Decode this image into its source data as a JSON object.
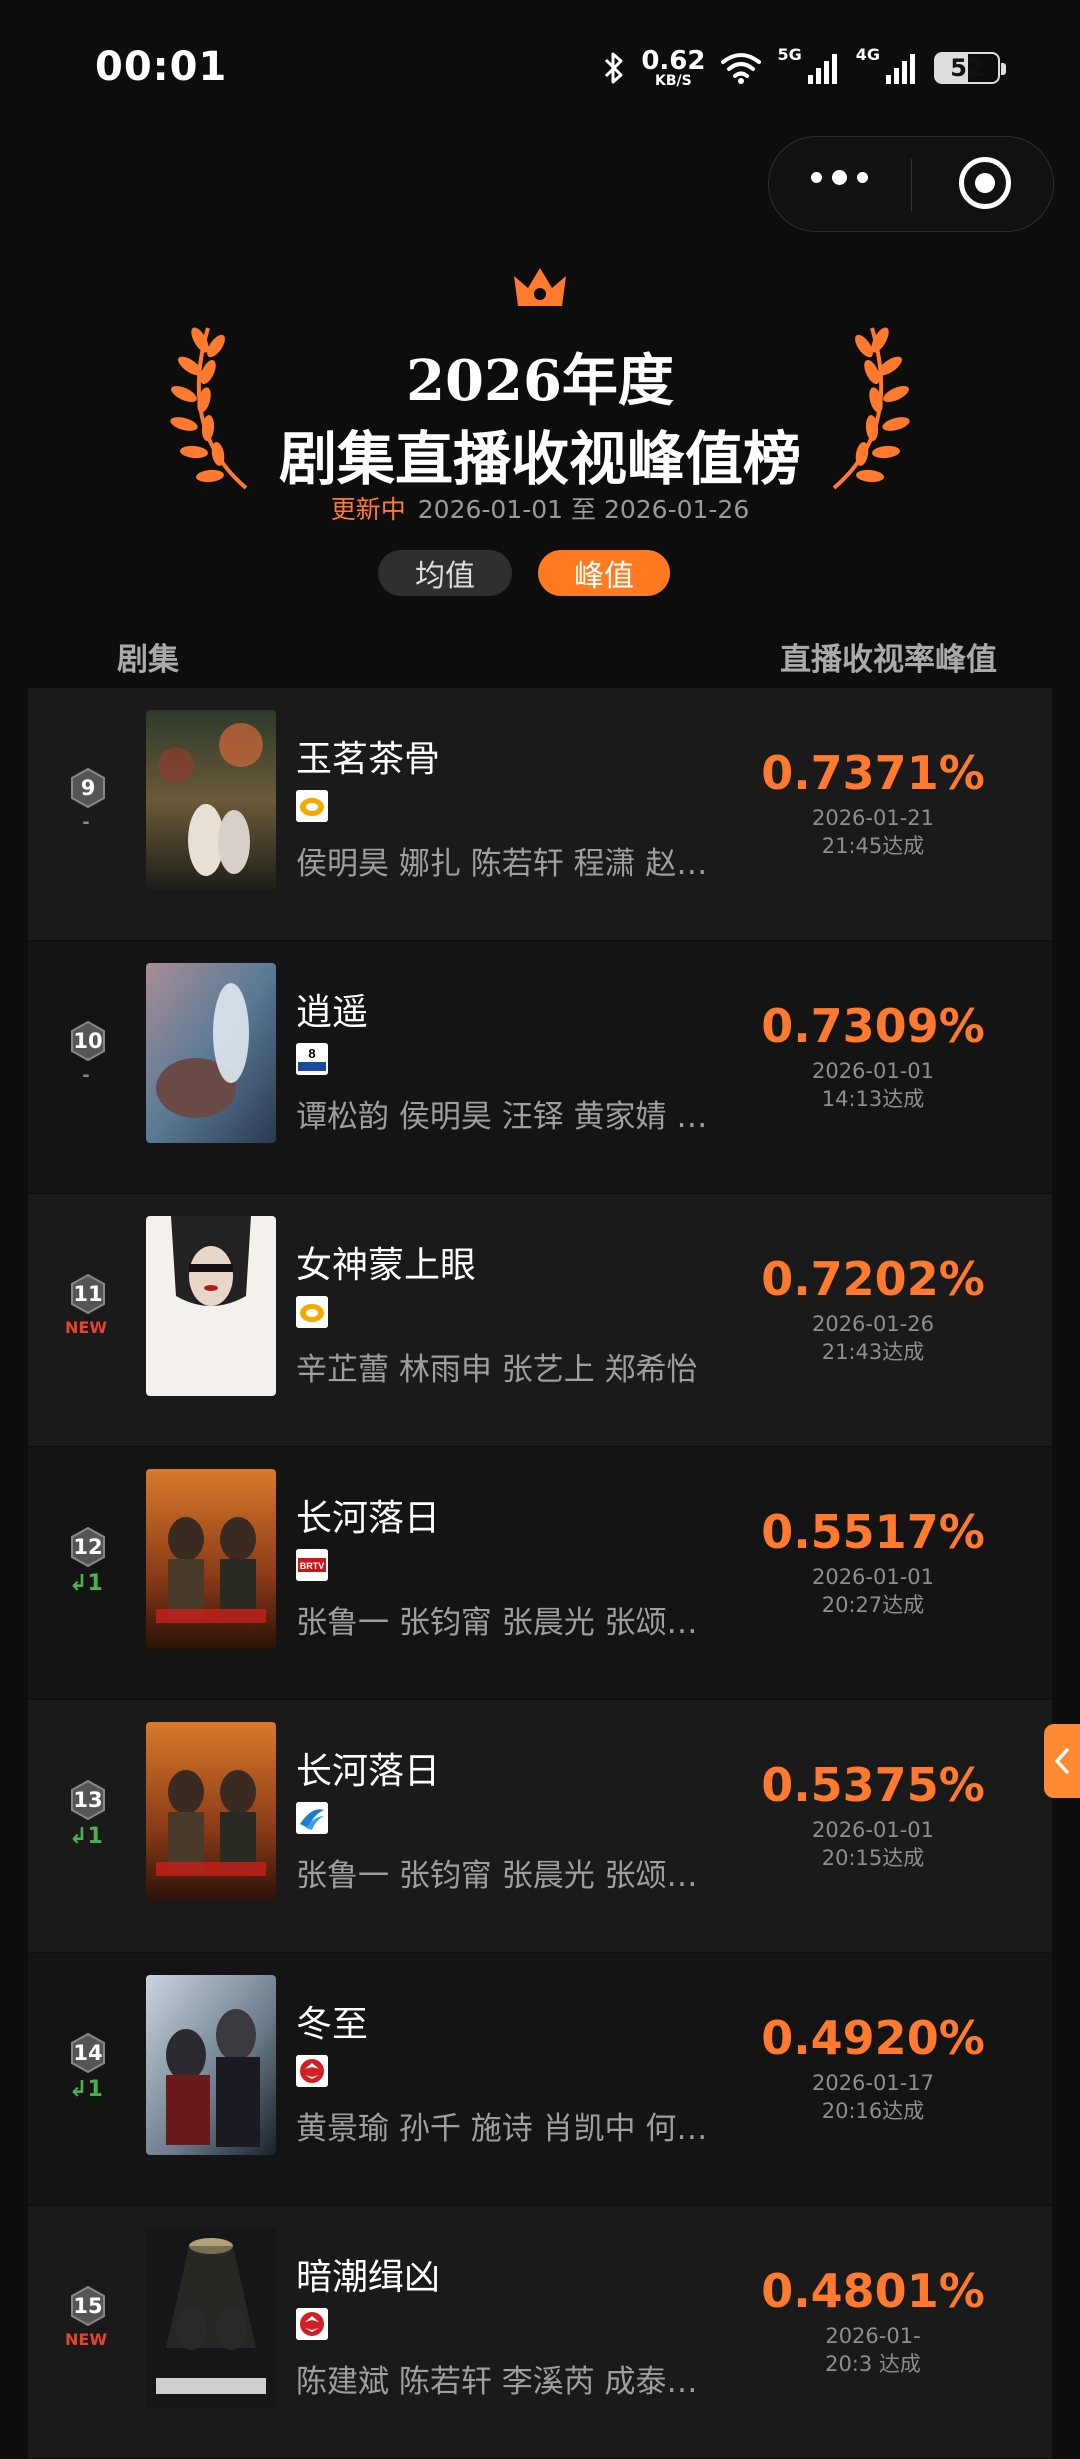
{
  "status": {
    "time": "00:01",
    "net_speed": "0.62",
    "net_unit": "KB/S",
    "net1": "5G",
    "net2": "4G",
    "battery": "52"
  },
  "header": {
    "title_line1": "2026年度",
    "title_line2": "剧集直播收视峰值榜",
    "update_status": "更新中",
    "date_range": "2026-01-01 至 2026-01-26"
  },
  "toggle": {
    "avg_label": "均值",
    "peak_label": "峰值",
    "selected": "峰值"
  },
  "columns": {
    "left": "剧集",
    "right": "直播收视率峰值"
  },
  "colors": {
    "accent": "#ff7a2f",
    "new": "#e8432b",
    "up": "#4caf50"
  },
  "rows": [
    {
      "rank": "9",
      "change": "-",
      "title": "玉茗茶骨",
      "channel": "hunan-tv-logo",
      "cast": "侯明昊 娜扎 陈若轩 程潇 赵…",
      "rating": "0.7371%",
      "date": "2026-01-21",
      "time": "21:45达成"
    },
    {
      "rank": "10",
      "change": "-",
      "title": "逍遥",
      "channel": "cctv8-logo",
      "cast": "谭松韵 侯明昊 汪铎 黄家婧 …",
      "rating": "0.7309%",
      "date": "2026-01-01",
      "time": "14:13达成"
    },
    {
      "rank": "11",
      "change": "NEW",
      "title": "女神蒙上眼",
      "channel": "hunan-tv-logo",
      "cast": "辛芷蕾 林雨申 张艺上 郑希怡",
      "rating": "0.7202%",
      "date": "2026-01-26",
      "time": "21:43达成"
    },
    {
      "rank": "12",
      "change": "↲1",
      "title": "长河落日",
      "channel": "btv-logo",
      "cast": "张鲁一 张钧甯 张晨光 张颂…",
      "rating": "0.5517%",
      "date": "2026-01-01",
      "time": "20:27达成"
    },
    {
      "rank": "13",
      "change": "↲1",
      "title": "长河落日",
      "channel": "zhejiang-tv-logo",
      "cast": "张鲁一 张钧甯 张晨光 张颂…",
      "rating": "0.5375%",
      "date": "2026-01-01",
      "time": "20:15达成"
    },
    {
      "rank": "14",
      "change": "↲1",
      "title": "冬至",
      "channel": "jiangsu-tv-logo",
      "cast": "黄景瑜 孙千 施诗 肖凯中 何…",
      "rating": "0.4920%",
      "date": "2026-01-17",
      "time": "20:16达成"
    },
    {
      "rank": "15",
      "change": "NEW",
      "title": "暗潮缉凶",
      "channel": "jiangsu-tv-logo",
      "cast": "陈建斌 陈若轩 李溪芮 成泰…",
      "rating": "0.4801%",
      "date": "2026-01-",
      "time": "20:3 达成"
    }
  ]
}
